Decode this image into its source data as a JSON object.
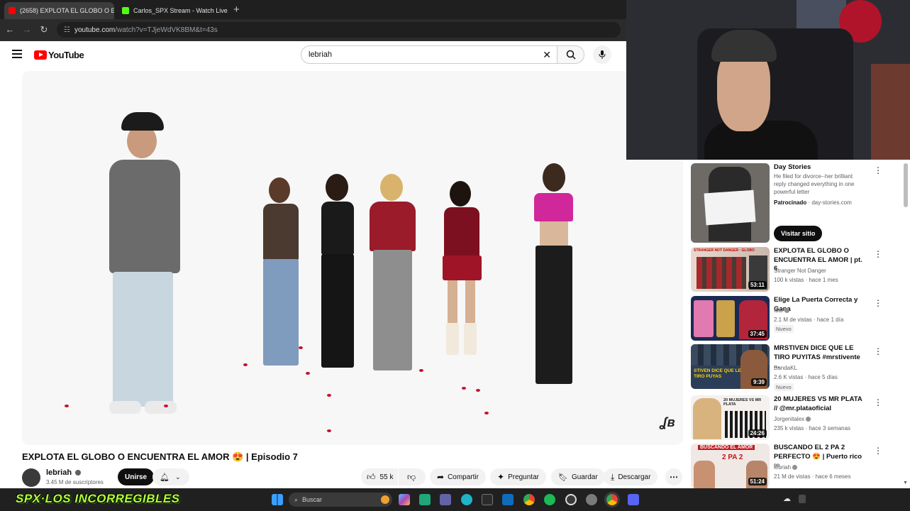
{
  "browser": {
    "tabs": [
      {
        "title": "(2658) EXPLOTA EL GLOBO O E",
        "favicon_color": "#ff0000",
        "active": true
      },
      {
        "title": "Carlos_SPX Stream - Watch Live",
        "favicon_color": "#53fc18",
        "active": false
      }
    ],
    "url_host": "youtube.com",
    "url_path": "/watch?v=TJjeWdVK8BM&t=43s"
  },
  "youtube": {
    "logo_text": "YouTube",
    "search_value": "lebriah",
    "video": {
      "title": "EXPLOTA EL GLOBO O ENCUENTRA EL AMOR 😍 | Episodio 7",
      "channel": "lebriah",
      "subscribers": "3.45 M de suscriptores",
      "join_label": "Unirse",
      "likes": "55 k",
      "share_label": "Compartir",
      "ask_label": "Preguntar",
      "save_label": "Guardar",
      "download_label": "Descargar"
    },
    "recommendations": [
      {
        "title": "Day Stories",
        "line2": "He filed for divorce--her brilliant reply changed everything in one powerful letter",
        "sponsor_label": "Patrocinado",
        "sponsor_host": "day-stories.com",
        "cta": "Visitar sitio"
      },
      {
        "title": "EXPLOTA EL GLOBO O ENCUENTRA EL AMOR | pt. 6",
        "channel": "Stranger Not Danger",
        "meta": "100 k vistas · hace 1 mes",
        "duration": "53:11"
      },
      {
        "title": "Elige La Puerta Correcta y Gana",
        "channel": "Ibai",
        "meta": "2.1 M de vistas · hace 1 día",
        "badge": "Nuevo",
        "duration": "37:45"
      },
      {
        "title": "MRSTIVEN DICE QUE LE TIRO PUYITAS #mrstivente ...",
        "channel": "BandaKL",
        "meta": "2.6 K vistas · hace 5 días",
        "badge": "Nuevo",
        "duration": "9:39"
      },
      {
        "title": "20 MUJERES VS MR PLATA // @mr.plataoficial",
        "channel": "Jorgenitalex",
        "meta": "235 k vistas · hace 3 semanas",
        "duration": "24:26"
      },
      {
        "title": "BUSCANDO EL 2 PA 2 PERFECTO 😍 | Puerto rico",
        "title_suffix": "PR",
        "channel": "lebriah",
        "meta": "21 M de vistas · hace 6 meses",
        "duration": "51:24"
      }
    ],
    "thumb_texts": {
      "rec1": "STRANGER NOT DANGER · GLOBO",
      "rec3": "STIVEN DICE QUE LE TIRO PUYAS",
      "rec4": "20 MUJERES VS MR PLATA",
      "rec5a": "BUSCANDO EL AMOR",
      "rec5b": "2 PA 2"
    }
  },
  "overlay": {
    "streamer_logo": "SPX·LOS INCORREGIBLES"
  },
  "taskbar": {
    "search_placeholder": "Buscar"
  }
}
